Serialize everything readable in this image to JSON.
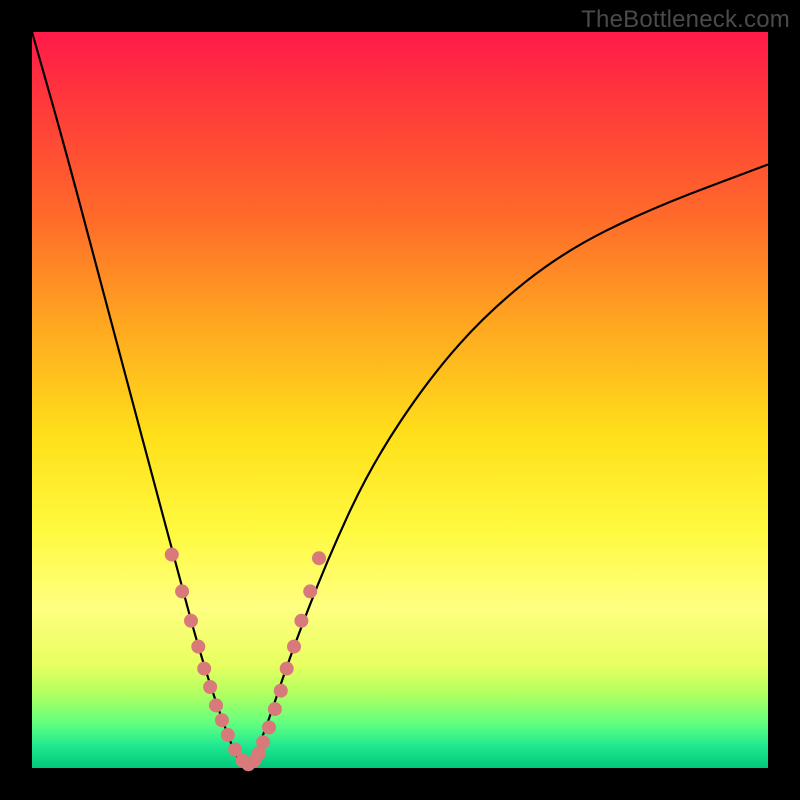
{
  "watermark": "TheBottleneck.com",
  "colors": {
    "background": "#000000",
    "gradient_top": "#ff1a4a",
    "gradient_bottom": "#00c878",
    "curve": "#000000",
    "marker": "#d97a7a"
  },
  "chart_data": {
    "type": "line",
    "title": "",
    "xlabel": "",
    "ylabel": "",
    "xlim": [
      0,
      100
    ],
    "ylim": [
      0,
      100
    ],
    "description": "Bottleneck curve: percentage bottleneck (y) vs component balance (x). Minimum near x≈29 where bottleneck ≈0%.",
    "series": [
      {
        "name": "bottleneck-curve",
        "x": [
          0,
          4,
          8,
          12,
          16,
          20,
          23,
          26,
          28,
          29,
          30,
          32,
          35,
          40,
          46,
          54,
          62,
          72,
          84,
          100
        ],
        "y": [
          100,
          86,
          71,
          56,
          41,
          26,
          15,
          6,
          1,
          0,
          1,
          6,
          15,
          28,
          41,
          53,
          62,
          70,
          76,
          82
        ]
      }
    ],
    "markers": {
      "name": "highlight-points",
      "x": [
        19.0,
        20.4,
        21.6,
        22.6,
        23.4,
        24.2,
        25.0,
        25.8,
        26.6,
        27.6,
        28.6,
        29.4,
        30.2,
        30.8,
        31.4,
        32.2,
        33.0,
        33.8,
        34.6,
        35.6,
        36.6,
        37.8,
        39.0
      ],
      "y": [
        29.0,
        24.0,
        20.0,
        16.5,
        13.5,
        11.0,
        8.5,
        6.5,
        4.5,
        2.5,
        1.0,
        0.5,
        1.0,
        2.0,
        3.5,
        5.5,
        8.0,
        10.5,
        13.5,
        16.5,
        20.0,
        24.0,
        28.5
      ]
    }
  }
}
